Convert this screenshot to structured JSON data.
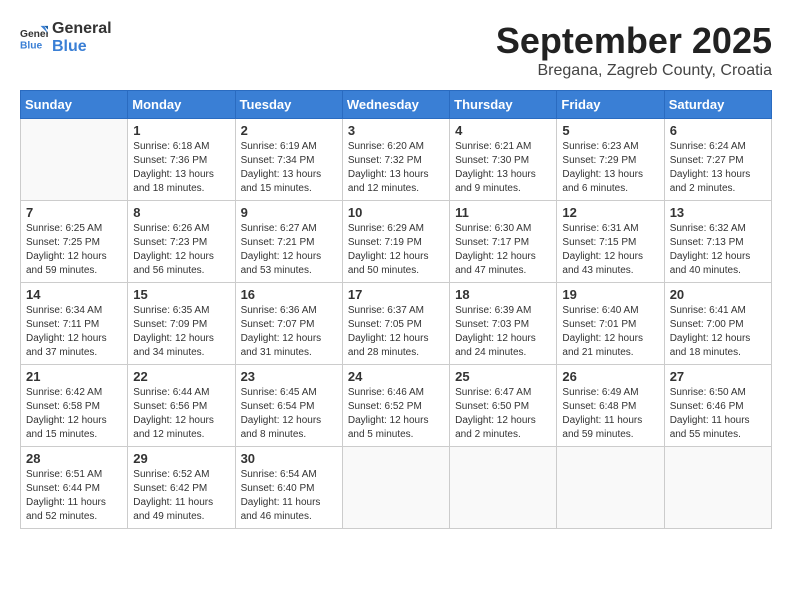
{
  "header": {
    "logo_general": "General",
    "logo_blue": "Blue",
    "month": "September 2025",
    "location": "Bregana, Zagreb County, Croatia"
  },
  "weekdays": [
    "Sunday",
    "Monday",
    "Tuesday",
    "Wednesday",
    "Thursday",
    "Friday",
    "Saturday"
  ],
  "weeks": [
    [
      {
        "day": "",
        "sunrise": "",
        "sunset": "",
        "daylight": ""
      },
      {
        "day": "1",
        "sunrise": "Sunrise: 6:18 AM",
        "sunset": "Sunset: 7:36 PM",
        "daylight": "Daylight: 13 hours and 18 minutes."
      },
      {
        "day": "2",
        "sunrise": "Sunrise: 6:19 AM",
        "sunset": "Sunset: 7:34 PM",
        "daylight": "Daylight: 13 hours and 15 minutes."
      },
      {
        "day": "3",
        "sunrise": "Sunrise: 6:20 AM",
        "sunset": "Sunset: 7:32 PM",
        "daylight": "Daylight: 13 hours and 12 minutes."
      },
      {
        "day": "4",
        "sunrise": "Sunrise: 6:21 AM",
        "sunset": "Sunset: 7:30 PM",
        "daylight": "Daylight: 13 hours and 9 minutes."
      },
      {
        "day": "5",
        "sunrise": "Sunrise: 6:23 AM",
        "sunset": "Sunset: 7:29 PM",
        "daylight": "Daylight: 13 hours and 6 minutes."
      },
      {
        "day": "6",
        "sunrise": "Sunrise: 6:24 AM",
        "sunset": "Sunset: 7:27 PM",
        "daylight": "Daylight: 13 hours and 2 minutes."
      }
    ],
    [
      {
        "day": "7",
        "sunrise": "Sunrise: 6:25 AM",
        "sunset": "Sunset: 7:25 PM",
        "daylight": "Daylight: 12 hours and 59 minutes."
      },
      {
        "day": "8",
        "sunrise": "Sunrise: 6:26 AM",
        "sunset": "Sunset: 7:23 PM",
        "daylight": "Daylight: 12 hours and 56 minutes."
      },
      {
        "day": "9",
        "sunrise": "Sunrise: 6:27 AM",
        "sunset": "Sunset: 7:21 PM",
        "daylight": "Daylight: 12 hours and 53 minutes."
      },
      {
        "day": "10",
        "sunrise": "Sunrise: 6:29 AM",
        "sunset": "Sunset: 7:19 PM",
        "daylight": "Daylight: 12 hours and 50 minutes."
      },
      {
        "day": "11",
        "sunrise": "Sunrise: 6:30 AM",
        "sunset": "Sunset: 7:17 PM",
        "daylight": "Daylight: 12 hours and 47 minutes."
      },
      {
        "day": "12",
        "sunrise": "Sunrise: 6:31 AM",
        "sunset": "Sunset: 7:15 PM",
        "daylight": "Daylight: 12 hours and 43 minutes."
      },
      {
        "day": "13",
        "sunrise": "Sunrise: 6:32 AM",
        "sunset": "Sunset: 7:13 PM",
        "daylight": "Daylight: 12 hours and 40 minutes."
      }
    ],
    [
      {
        "day": "14",
        "sunrise": "Sunrise: 6:34 AM",
        "sunset": "Sunset: 7:11 PM",
        "daylight": "Daylight: 12 hours and 37 minutes."
      },
      {
        "day": "15",
        "sunrise": "Sunrise: 6:35 AM",
        "sunset": "Sunset: 7:09 PM",
        "daylight": "Daylight: 12 hours and 34 minutes."
      },
      {
        "day": "16",
        "sunrise": "Sunrise: 6:36 AM",
        "sunset": "Sunset: 7:07 PM",
        "daylight": "Daylight: 12 hours and 31 minutes."
      },
      {
        "day": "17",
        "sunrise": "Sunrise: 6:37 AM",
        "sunset": "Sunset: 7:05 PM",
        "daylight": "Daylight: 12 hours and 28 minutes."
      },
      {
        "day": "18",
        "sunrise": "Sunrise: 6:39 AM",
        "sunset": "Sunset: 7:03 PM",
        "daylight": "Daylight: 12 hours and 24 minutes."
      },
      {
        "day": "19",
        "sunrise": "Sunrise: 6:40 AM",
        "sunset": "Sunset: 7:01 PM",
        "daylight": "Daylight: 12 hours and 21 minutes."
      },
      {
        "day": "20",
        "sunrise": "Sunrise: 6:41 AM",
        "sunset": "Sunset: 7:00 PM",
        "daylight": "Daylight: 12 hours and 18 minutes."
      }
    ],
    [
      {
        "day": "21",
        "sunrise": "Sunrise: 6:42 AM",
        "sunset": "Sunset: 6:58 PM",
        "daylight": "Daylight: 12 hours and 15 minutes."
      },
      {
        "day": "22",
        "sunrise": "Sunrise: 6:44 AM",
        "sunset": "Sunset: 6:56 PM",
        "daylight": "Daylight: 12 hours and 12 minutes."
      },
      {
        "day": "23",
        "sunrise": "Sunrise: 6:45 AM",
        "sunset": "Sunset: 6:54 PM",
        "daylight": "Daylight: 12 hours and 8 minutes."
      },
      {
        "day": "24",
        "sunrise": "Sunrise: 6:46 AM",
        "sunset": "Sunset: 6:52 PM",
        "daylight": "Daylight: 12 hours and 5 minutes."
      },
      {
        "day": "25",
        "sunrise": "Sunrise: 6:47 AM",
        "sunset": "Sunset: 6:50 PM",
        "daylight": "Daylight: 12 hours and 2 minutes."
      },
      {
        "day": "26",
        "sunrise": "Sunrise: 6:49 AM",
        "sunset": "Sunset: 6:48 PM",
        "daylight": "Daylight: 11 hours and 59 minutes."
      },
      {
        "day": "27",
        "sunrise": "Sunrise: 6:50 AM",
        "sunset": "Sunset: 6:46 PM",
        "daylight": "Daylight: 11 hours and 55 minutes."
      }
    ],
    [
      {
        "day": "28",
        "sunrise": "Sunrise: 6:51 AM",
        "sunset": "Sunset: 6:44 PM",
        "daylight": "Daylight: 11 hours and 52 minutes."
      },
      {
        "day": "29",
        "sunrise": "Sunrise: 6:52 AM",
        "sunset": "Sunset: 6:42 PM",
        "daylight": "Daylight: 11 hours and 49 minutes."
      },
      {
        "day": "30",
        "sunrise": "Sunrise: 6:54 AM",
        "sunset": "Sunset: 6:40 PM",
        "daylight": "Daylight: 11 hours and 46 minutes."
      },
      {
        "day": "",
        "sunrise": "",
        "sunset": "",
        "daylight": ""
      },
      {
        "day": "",
        "sunrise": "",
        "sunset": "",
        "daylight": ""
      },
      {
        "day": "",
        "sunrise": "",
        "sunset": "",
        "daylight": ""
      },
      {
        "day": "",
        "sunrise": "",
        "sunset": "",
        "daylight": ""
      }
    ]
  ]
}
